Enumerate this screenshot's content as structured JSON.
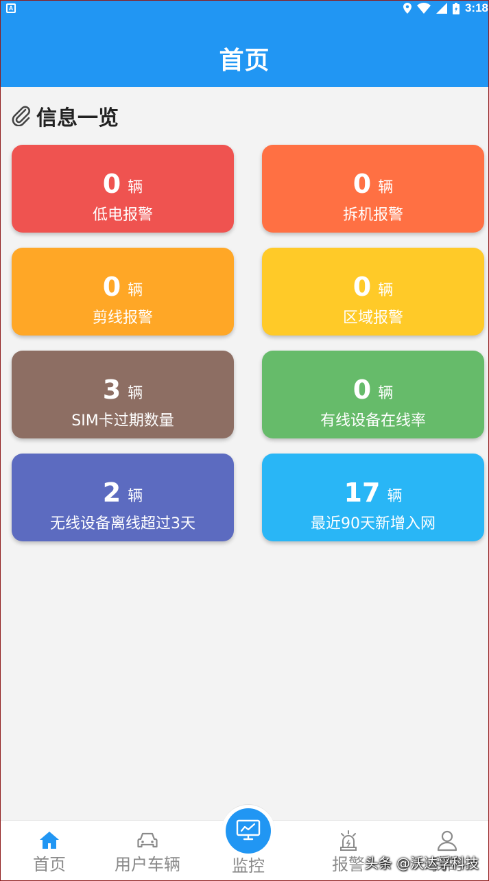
{
  "status_bar": {
    "time": "3:18"
  },
  "header": {
    "title": "首页"
  },
  "section": {
    "title": "信息一览"
  },
  "cards": [
    {
      "value": "0",
      "unit": "辆",
      "label": "低电报警",
      "color": "#ef5350"
    },
    {
      "value": "0",
      "unit": "辆",
      "label": "拆机报警",
      "color": "#ff7043"
    },
    {
      "value": "0",
      "unit": "辆",
      "label": "剪线报警",
      "color": "#ffa726"
    },
    {
      "value": "0",
      "unit": "辆",
      "label": "区域报警",
      "color": "#ffca28"
    },
    {
      "value": "3",
      "unit": "辆",
      "label": "SIM卡过期数量",
      "color": "#8d6e63"
    },
    {
      "value": "0",
      "unit": "辆",
      "label": "有线设备在线率",
      "color": "#66bb6a"
    },
    {
      "value": "2",
      "unit": "辆",
      "label": "无线设备离线超过3天",
      "color": "#5c6bc0"
    },
    {
      "value": "17",
      "unit": "辆",
      "label": "最近90天新增入网",
      "color": "#29b6f6"
    }
  ],
  "bottom_nav": {
    "items": [
      {
        "label": "首页",
        "icon": "home-icon",
        "active": true
      },
      {
        "label": "用户车辆",
        "icon": "car-icon",
        "active": false
      },
      {
        "label": "监控",
        "icon": "monitor-icon",
        "active": false
      },
      {
        "label": "报警",
        "icon": "alarm-siren-icon",
        "active": false
      },
      {
        "label": "我的",
        "icon": "user-icon",
        "active": false
      }
    ]
  },
  "watermark": "头条 @沃达孚科技",
  "colors": {
    "primary": "#2196f3",
    "background": "#f3f3f3"
  }
}
